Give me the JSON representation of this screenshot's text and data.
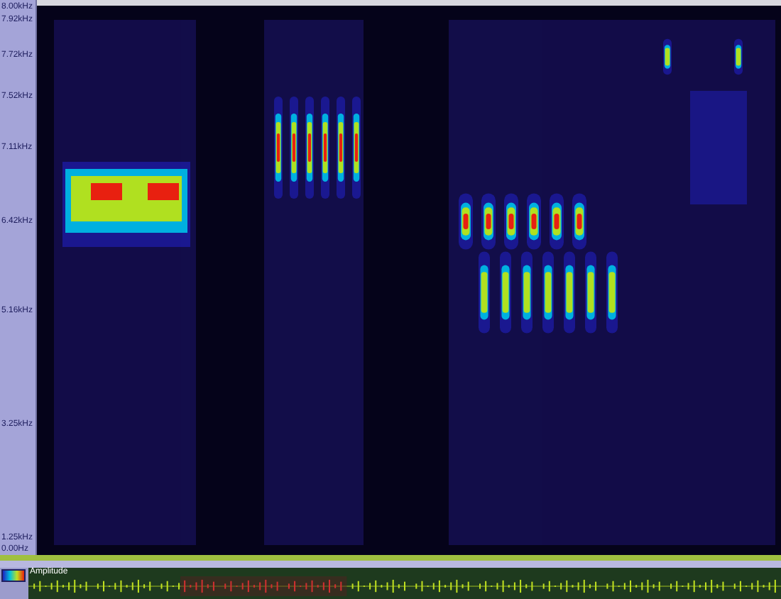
{
  "frequency_axis": {
    "labels": [
      "8.00kHz",
      "7.92kHz",
      "7.72kHz",
      "7.52kHz",
      "7.11kHz",
      "6.42kHz",
      "5.16kHz",
      "3.25kHz",
      "1.25kHz",
      "0.00Hz"
    ]
  },
  "waveform": {
    "title": "Amplitude"
  }
}
